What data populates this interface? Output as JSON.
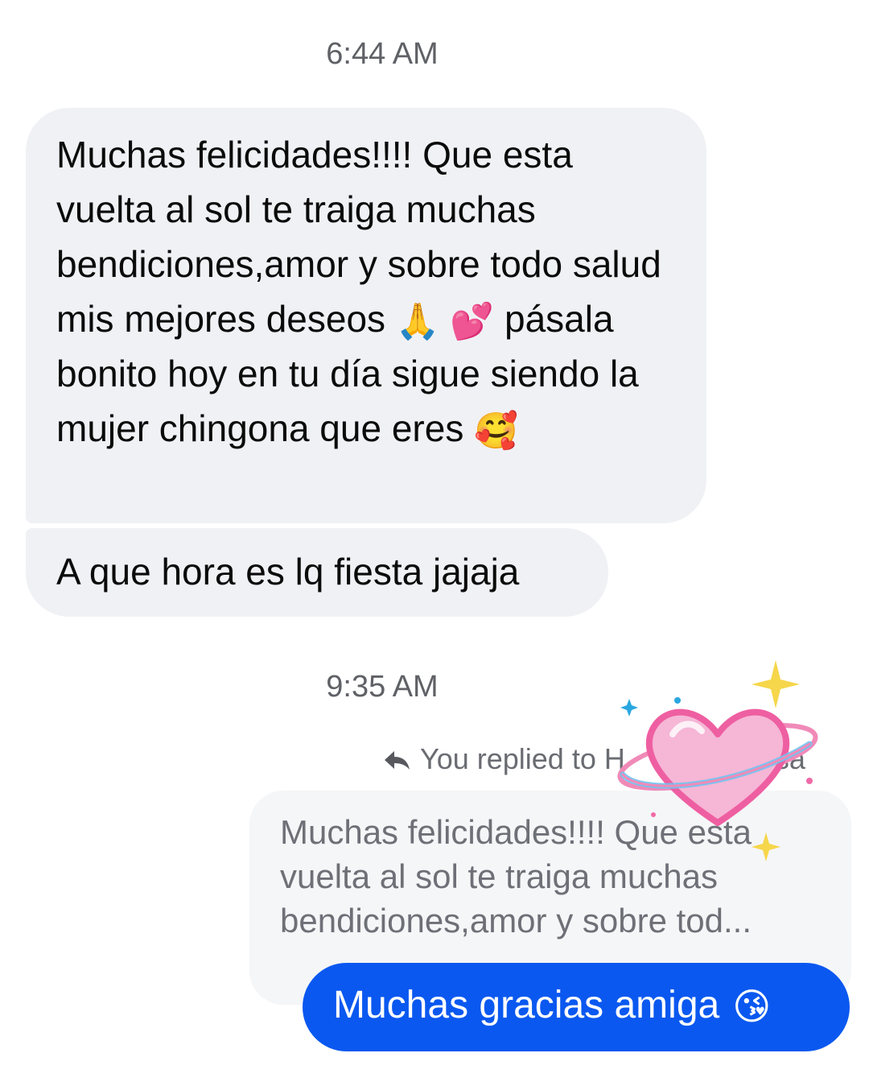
{
  "thread": {
    "timestamp_1": "6:44 AM",
    "incoming": [
      {
        "text": "Muchas felicidades!!!! Que esta vuelta al sol  te traiga muchas bendiciones,amor y sobre todo salud mis mejores deseos",
        "emoji_1": "🙏",
        "emoji_2": "💕",
        "text_2": "pásala bonito hoy en tu día sigue siendo la mujer chingona que eres",
        "emoji_3": "🥰"
      },
      {
        "text": "A que hora es lq fiesta jajaja"
      }
    ],
    "timestamp_2": "9:35 AM",
    "reply": {
      "label": "You replied to H",
      "label_tail": "sa",
      "quoted_text": "Muchas felicidades!!!! Que esta vuelta al sol  te traiga muchas bendiciones,amor y sobre tod...",
      "outgoing_text": "Muchas gracias amiga",
      "outgoing_emoji": "😘"
    }
  },
  "colors": {
    "incoming_bubble": "#f0f1f5",
    "outgoing_bubble": "#0a58f0",
    "quoted_bubble": "#f5f6f8",
    "timestamp_text": "#5f6166",
    "sticker_heart": "#f06aa8"
  },
  "icons": {
    "reply": "reply-arrow-icon",
    "sticker": "heart-with-ring-sticker"
  }
}
